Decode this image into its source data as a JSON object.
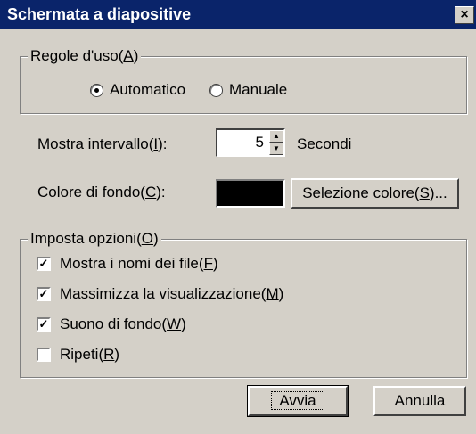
{
  "window": {
    "title": "Schermata a diapositive",
    "close_glyph": "×"
  },
  "usage_group": {
    "legend_prefix": "Regole d'uso(",
    "legend_key": "A",
    "legend_suffix": ")",
    "options": [
      {
        "label": "Automatico",
        "selected": true
      },
      {
        "label": "Manuale",
        "selected": false
      }
    ]
  },
  "interval": {
    "label_prefix": "Mostra intervallo(",
    "label_key": "I",
    "label_suffix": "):",
    "value": "5",
    "unit": "Secondi"
  },
  "background": {
    "label_prefix": "Colore di fondo(",
    "label_key": "C",
    "label_suffix": "):",
    "color": "#000000",
    "button_prefix": "Selezione colore(",
    "button_key": "S",
    "button_suffix": ")..."
  },
  "options_group": {
    "legend_prefix": "Imposta opzioni(",
    "legend_key": "O",
    "legend_suffix": ")",
    "items": [
      {
        "label_prefix": "Mostra i nomi dei file(",
        "key": "F",
        "label_suffix": ")",
        "checked": true
      },
      {
        "label_prefix": "Massimizza la visualizzazione(",
        "key": "M",
        "label_suffix": ")",
        "checked": true
      },
      {
        "label_prefix": "Suono di fondo(",
        "key": "W",
        "label_suffix": ")",
        "checked": true
      },
      {
        "label_prefix": "Ripeti(",
        "key": "R",
        "label_suffix": ")",
        "checked": false
      }
    ]
  },
  "buttons": {
    "start": "Avvia",
    "cancel": "Annulla"
  }
}
